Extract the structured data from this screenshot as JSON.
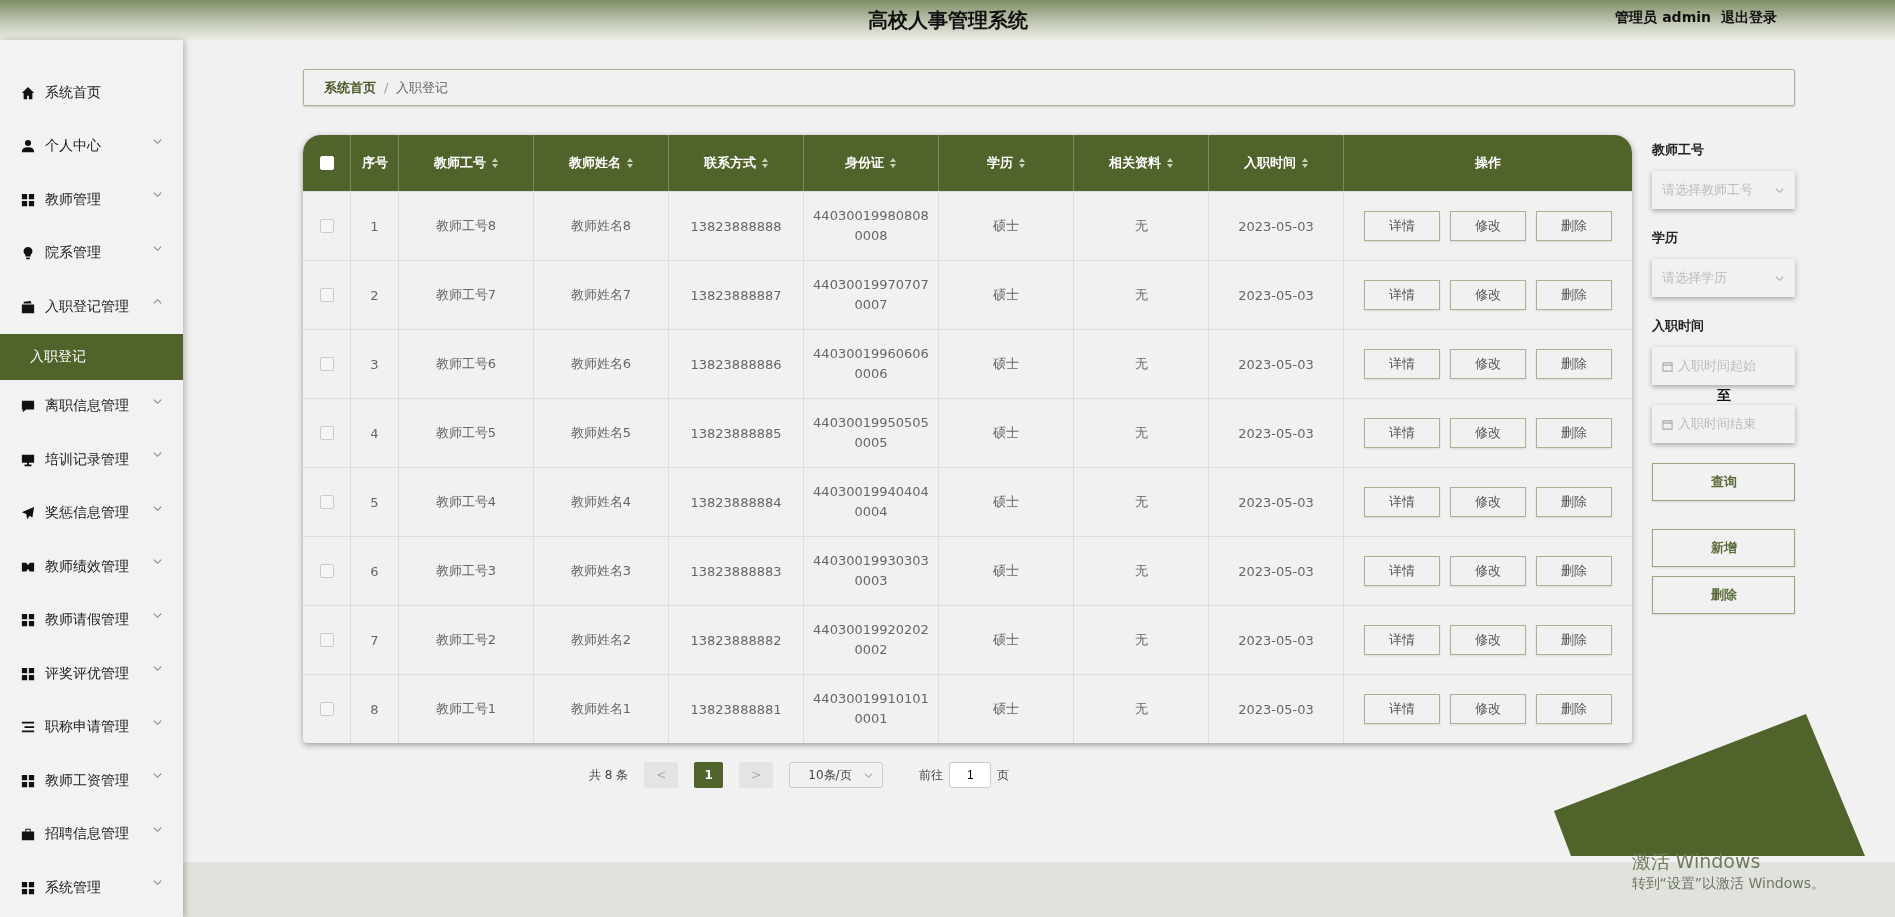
{
  "header": {
    "title": "高校人事管理系统",
    "user": "管理员 admin",
    "logout": "退出登录"
  },
  "sidebar": {
    "items": [
      {
        "label": "系统首页"
      },
      {
        "label": "个人中心",
        "expanded": false
      },
      {
        "label": "教师管理",
        "expanded": false
      },
      {
        "label": "院系管理",
        "expanded": false
      },
      {
        "label": "入职登记管理",
        "expanded": true,
        "children": [
          {
            "label": "入职登记",
            "selected": true
          }
        ]
      },
      {
        "label": "离职信息管理",
        "expanded": false
      },
      {
        "label": "培训记录管理",
        "expanded": false
      },
      {
        "label": "奖惩信息管理",
        "expanded": false
      },
      {
        "label": "教师绩效管理",
        "expanded": false
      },
      {
        "label": "教师请假管理",
        "expanded": false
      },
      {
        "label": "评奖评优管理",
        "expanded": false
      },
      {
        "label": "职称申请管理",
        "expanded": false
      },
      {
        "label": "教师工资管理",
        "expanded": false
      },
      {
        "label": "招聘信息管理",
        "expanded": false
      },
      {
        "label": "系统管理",
        "expanded": false
      }
    ]
  },
  "breadcrumb": [
    "系统首页",
    "入职登记"
  ],
  "breadcrumb_separator": "/",
  "table": {
    "all_checked": false,
    "columns": [
      {
        "label": "序号",
        "sortable": false
      },
      {
        "label": "教师工号",
        "sortable": true
      },
      {
        "label": "教师姓名",
        "sortable": true
      },
      {
        "label": "联系方式",
        "sortable": true
      },
      {
        "label": "身份证",
        "sortable": true
      },
      {
        "label": "学历",
        "sortable": true
      },
      {
        "label": "相关资料",
        "sortable": true
      },
      {
        "label": "入职时间",
        "sortable": true
      },
      {
        "label": "操作",
        "sortable": false
      }
    ],
    "rows": [
      {
        "checked": false,
        "cells": [
          "1",
          "教师工号8",
          "教师姓名8",
          "13823888888",
          "440300199808080008",
          "硕士",
          "无",
          "2023-05-03"
        ],
        "actions": [
          "详情",
          "修改",
          "删除"
        ]
      },
      {
        "checked": false,
        "cells": [
          "2",
          "教师工号7",
          "教师姓名7",
          "13823888887",
          "440300199707070007",
          "硕士",
          "无",
          "2023-05-03"
        ],
        "actions": [
          "详情",
          "修改",
          "删除"
        ]
      },
      {
        "checked": false,
        "cells": [
          "3",
          "教师工号6",
          "教师姓名6",
          "13823888886",
          "440300199606060006",
          "硕士",
          "无",
          "2023-05-03"
        ],
        "actions": [
          "详情",
          "修改",
          "删除"
        ]
      },
      {
        "checked": false,
        "cells": [
          "4",
          "教师工号5",
          "教师姓名5",
          "13823888885",
          "440300199505050005",
          "硕士",
          "无",
          "2023-05-03"
        ],
        "actions": [
          "详情",
          "修改",
          "删除"
        ]
      },
      {
        "checked": false,
        "cells": [
          "5",
          "教师工号4",
          "教师姓名4",
          "13823888884",
          "440300199404040004",
          "硕士",
          "无",
          "2023-05-03"
        ],
        "actions": [
          "详情",
          "修改",
          "删除"
        ]
      },
      {
        "checked": false,
        "cells": [
          "6",
          "教师工号3",
          "教师姓名3",
          "13823888883",
          "440300199303030003",
          "硕士",
          "无",
          "2023-05-03"
        ],
        "actions": [
          "详情",
          "修改",
          "删除"
        ]
      },
      {
        "checked": false,
        "cells": [
          "7",
          "教师工号2",
          "教师姓名2",
          "13823888882",
          "440300199202020002",
          "硕士",
          "无",
          "2023-05-03"
        ],
        "actions": [
          "详情",
          "修改",
          "删除"
        ]
      },
      {
        "checked": false,
        "cells": [
          "8",
          "教师工号1",
          "教师姓名1",
          "13823888881",
          "440300199101010001",
          "硕士",
          "无",
          "2023-05-03"
        ],
        "actions": [
          "详情",
          "修改",
          "删除"
        ]
      }
    ]
  },
  "filters": [
    {
      "kind": "select",
      "label": "教师工号",
      "placeholder": "请选择教师工号"
    },
    {
      "kind": "select",
      "label": "学历",
      "placeholder": "请选择学历"
    },
    {
      "kind": "daterange",
      "label": "入职时间",
      "start_placeholder": "入职时间起始",
      "separator": "至",
      "end_placeholder": "入职时间结束"
    }
  ],
  "panel_buttons": [
    {
      "label": "查询"
    },
    {
      "label": "新增"
    },
    {
      "label": "删除"
    }
  ],
  "pagination": {
    "total": "共 8 条",
    "prev": "<",
    "pages": [
      {
        "label": "1",
        "selected": true
      }
    ],
    "next": ">",
    "page_size": "10条/页",
    "goto_label": "前往",
    "goto_value": "1",
    "goto_suffix": "页"
  },
  "os_notice": {
    "title": "激活 Windows",
    "text": "转到“设置”以激活 Windows。"
  }
}
